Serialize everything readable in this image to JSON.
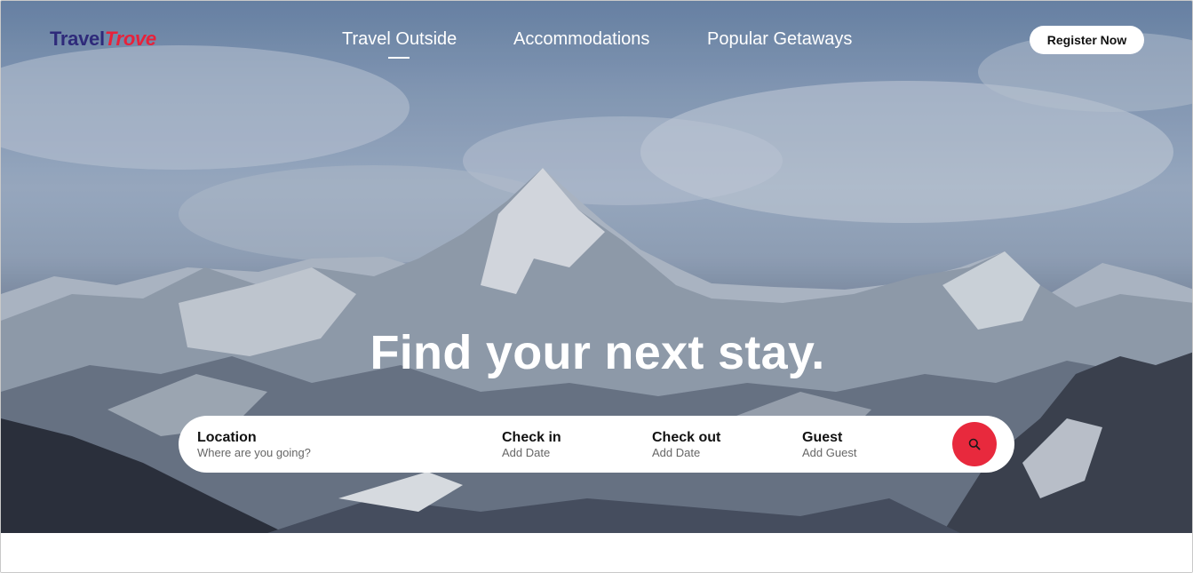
{
  "brand": {
    "part1": "Travel",
    "part2": "Trove",
    "color1": "#2e2a7a",
    "color2": "#e8213a"
  },
  "nav": {
    "items": [
      {
        "label": "Travel Outside",
        "active": true
      },
      {
        "label": "Accommodations",
        "active": false
      },
      {
        "label": "Popular Getaways",
        "active": false
      }
    ]
  },
  "header": {
    "register_label": "Register Now"
  },
  "hero": {
    "headline": "Find your next stay."
  },
  "search": {
    "fields": [
      {
        "label": "Location",
        "placeholder": "Where are you going?"
      },
      {
        "label": "Check in",
        "placeholder": "Add Date"
      },
      {
        "label": "Check out",
        "placeholder": "Add Date"
      },
      {
        "label": "Guest",
        "placeholder": "Add Guest"
      }
    ],
    "button_icon": "search-icon",
    "accent": "#e8293d"
  }
}
